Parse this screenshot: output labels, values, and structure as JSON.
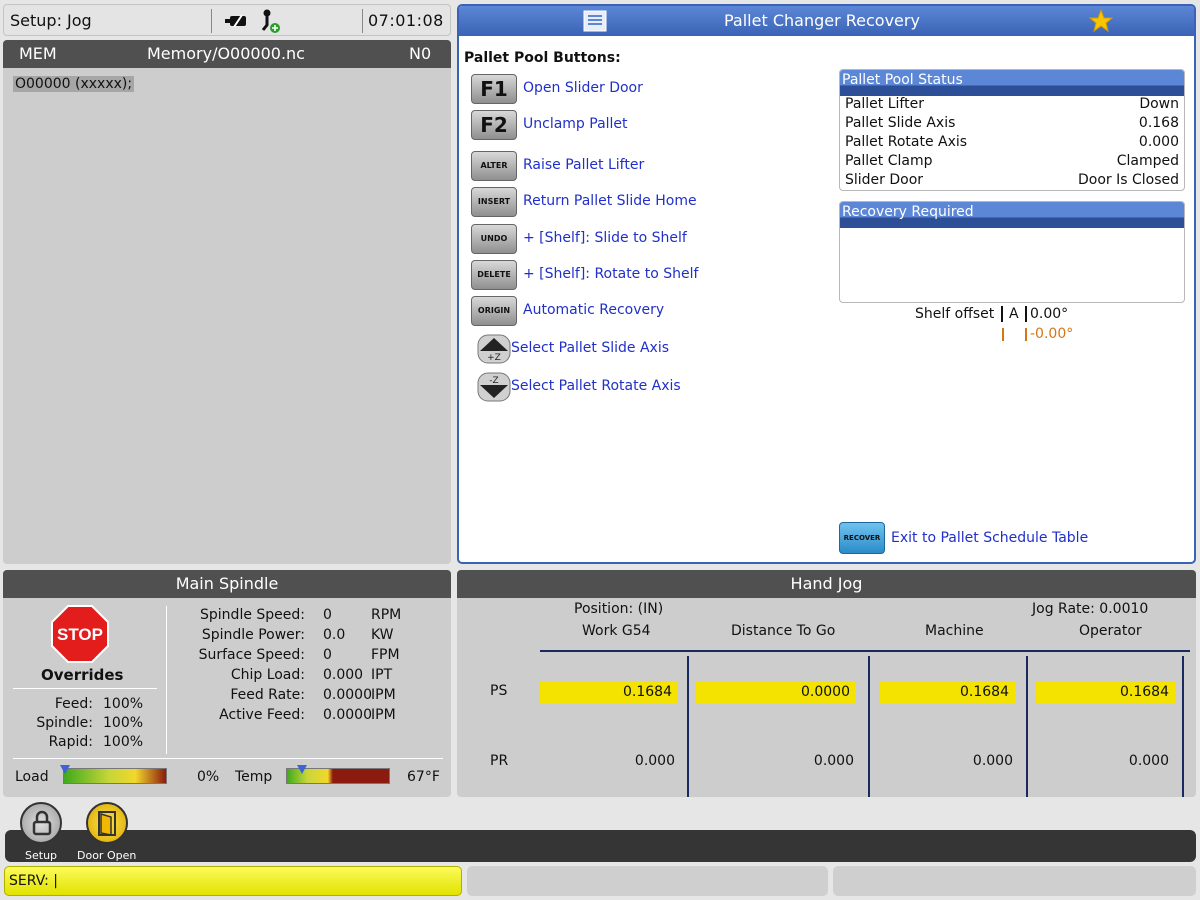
{
  "topbar": {
    "mode": "Setup: Jog",
    "time": "07:01:08",
    "icons": [
      "coolant-icon",
      "robot-arm-icon"
    ]
  },
  "program": {
    "mode": "MEM",
    "file": "Memory/O00000.nc",
    "line_no": "N0",
    "code_line": "O00000 (xxxxx);"
  },
  "pcr": {
    "title": "Pallet Changer Recovery",
    "buttons_title": "Pallet Pool Buttons:",
    "actions": [
      {
        "key": "F1",
        "label": "Open Slider Door"
      },
      {
        "key": "F2",
        "label": "Unclamp Pallet"
      },
      {
        "key": "ALTER",
        "label": "Raise Pallet Lifter"
      },
      {
        "key": "INSERT",
        "label": "Return Pallet Slide Home"
      },
      {
        "key": "UNDO",
        "label": "+ [Shelf]: Slide to Shelf"
      },
      {
        "key": "DELETE",
        "label": "+ [Shelf]: Rotate to Shelf"
      },
      {
        "key": "ORIGIN",
        "label": "Automatic Recovery"
      },
      {
        "key": "+Z",
        "label": "Select Pallet Slide Axis"
      },
      {
        "key": "-Z",
        "label": "Select Pallet Rotate Axis"
      }
    ],
    "status_title": "Pallet Pool Status",
    "status": [
      {
        "name": "Pallet Lifter",
        "value": "Down"
      },
      {
        "name": "Pallet Slide Axis",
        "value": "0.168"
      },
      {
        "name": "Pallet Rotate Axis",
        "value": "0.000"
      },
      {
        "name": "Pallet Clamp",
        "value": "Clamped"
      },
      {
        "name": "Slider Door",
        "value": "Door Is Closed"
      }
    ],
    "recovery_title": "Recovery Required",
    "shelf_label": "Shelf offset",
    "shelf_axis": "A",
    "shelf_value": "0.00°",
    "shelf_value2": "-0.00°",
    "recover_key": "RECOVER",
    "exit_label": "Exit to Pallet Schedule Table"
  },
  "spindle": {
    "title": "Main Spindle",
    "stop": "STOP",
    "overrides": "Overrides",
    "ovr": [
      {
        "name": "Feed:",
        "value": "100%"
      },
      {
        "name": "Spindle:",
        "value": "100%"
      },
      {
        "name": "Rapid:",
        "value": "100%"
      }
    ],
    "stats": [
      {
        "name": "Spindle Speed:",
        "value": "0",
        "unit": "RPM"
      },
      {
        "name": "Spindle Power:",
        "value": "0.0",
        "unit": "KW"
      },
      {
        "name": "Surface Speed:",
        "value": "0",
        "unit": "FPM"
      },
      {
        "name": "Chip Load:",
        "value": "0.000",
        "unit": "IPT"
      },
      {
        "name": "Feed Rate:",
        "value": "0.0000",
        "unit": "IPM"
      },
      {
        "name": "Active Feed:",
        "value": "0.0000",
        "unit": "IPM"
      }
    ],
    "load_label": "Load",
    "load_value": "0%",
    "temp_label": "Temp",
    "temp_value": "67°F"
  },
  "jog": {
    "title": "Hand Jog",
    "position_label": "Position: (IN)",
    "jog_rate": "Jog Rate: 0.0010",
    "columns": [
      "Work G54",
      "Distance To Go",
      "Machine",
      "Operator"
    ],
    "rows": [
      {
        "axis": "PS",
        "values": [
          "0.1684",
          "0.0000",
          "0.1684",
          "0.1684"
        ]
      },
      {
        "axis": "PR",
        "values": [
          "0.000",
          "0.000",
          "0.000",
          "0.000"
        ]
      }
    ]
  },
  "bottom": {
    "setup_label": "Setup",
    "door_label": "Door Open",
    "serv": "SERV:   |"
  }
}
